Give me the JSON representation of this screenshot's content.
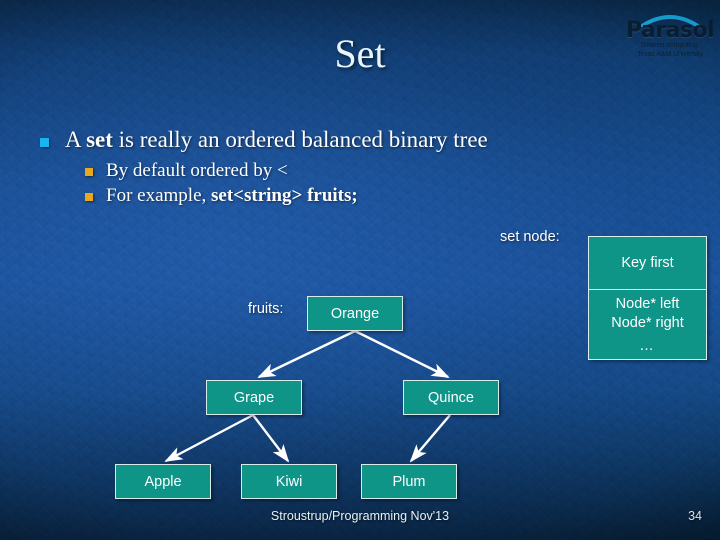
{
  "slide": {
    "title": "Set",
    "footer": "Stroustrup/Programming Nov'13",
    "page_number": "34",
    "accent_teal": "#0f9488",
    "accent_cyan_bullet": "#19b3f2",
    "accent_amber_bullet": "#e8a81c",
    "background_blue": "#164f92"
  },
  "logo": {
    "name": "Parasol",
    "tagline_line1": "Smarter computing.",
    "tagline_line2": "Texas A&M University"
  },
  "bullets": {
    "level1": {
      "prefix": "A ",
      "bold": "set",
      "suffix": " is really an ordered balanced binary tree"
    },
    "level2": [
      {
        "text": "By default ordered by <"
      },
      {
        "prefix": "For example, ",
        "bold": "set<string> fruits;"
      }
    ]
  },
  "diagram": {
    "labels": {
      "set_node": "set node:",
      "fruits": "fruits:"
    },
    "set_node_struct": {
      "key_field": "Key first",
      "left_field": "Node* left",
      "right_field": "Node* right",
      "more": "…"
    },
    "tree_nodes": [
      {
        "id": "orange",
        "label": "Orange"
      },
      {
        "id": "grape",
        "label": "Grape"
      },
      {
        "id": "quince",
        "label": "Quince"
      },
      {
        "id": "apple",
        "label": "Apple"
      },
      {
        "id": "kiwi",
        "label": "Kiwi"
      },
      {
        "id": "plum",
        "label": "Plum"
      }
    ]
  }
}
